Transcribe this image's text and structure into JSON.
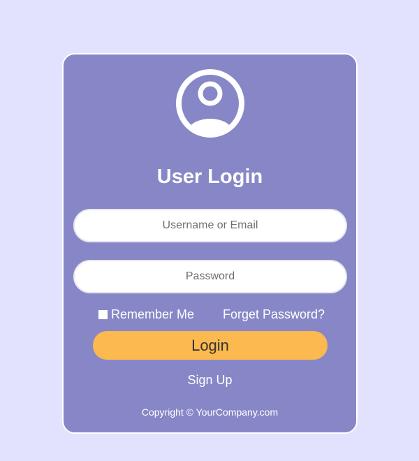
{
  "login": {
    "title": "User Login",
    "avatar_icon": "user-circle-icon",
    "username_placeholder": "Username or Email",
    "password_placeholder": "Password",
    "remember_label": "Remember Me",
    "remember_checked": false,
    "forgot_label": "Forget Password?",
    "login_button": "Login",
    "signup_label": "Sign Up",
    "copyright": "Copyright © YourCompany.com"
  },
  "colors": {
    "background": "#e2e2ff",
    "card": "#8787c7",
    "accent_button": "#fbb94f",
    "text_light": "#ffffff"
  }
}
